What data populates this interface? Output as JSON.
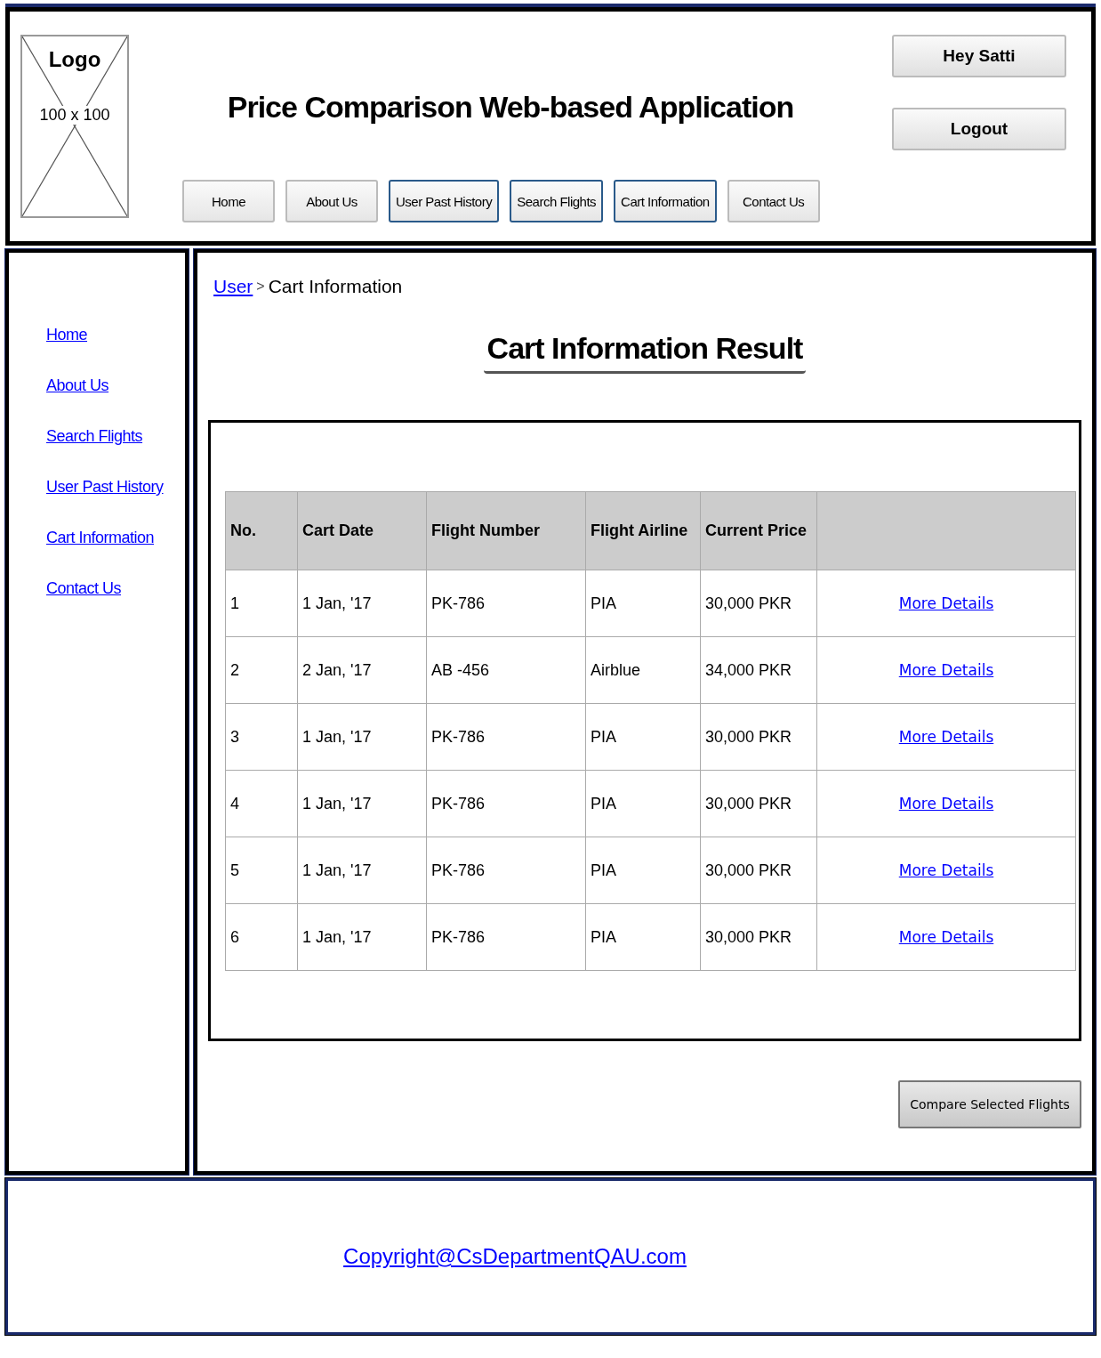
{
  "logo": {
    "label": "Logo",
    "size": "100 x 100"
  },
  "title": "Price Comparison Web-based Application",
  "user_buttons": [
    "Hey Satti",
    "Logout"
  ],
  "nav": [
    {
      "label": "Home",
      "kind": "plain"
    },
    {
      "label": "About Us",
      "kind": "plain"
    },
    {
      "label": "User Past History",
      "kind": "outlined"
    },
    {
      "label": "Search Flights",
      "kind": "outlined"
    },
    {
      "label": "Cart Information",
      "kind": "outlined"
    },
    {
      "label": "Contact Us",
      "kind": "plain"
    }
  ],
  "sidebar": {
    "items": [
      "Home",
      "About Us",
      "Search Flights",
      "User Past History",
      "Cart Information",
      "Contact Us"
    ]
  },
  "breadcrumb": {
    "link": "User",
    "separator": ">",
    "current": "Cart Information"
  },
  "heading": "Cart Information Result",
  "table": {
    "columns": [
      "No.",
      "Cart Date",
      "Flight Number",
      "Flight Airline",
      "Current Price"
    ],
    "rows": [
      {
        "cells": [
          "1",
          "1 Jan, '17",
          "PK-786",
          "PIA",
          "30,000 PKR"
        ],
        "link": "More Details"
      },
      {
        "cells": [
          "2",
          "2 Jan, '17",
          "AB -456",
          "Airblue",
          "34,000 PKR"
        ],
        "link": "More Details"
      },
      {
        "cells": [
          "3",
          "1 Jan, '17",
          "PK-786",
          "PIA",
          "30,000 PKR"
        ],
        "link": "More Details"
      },
      {
        "cells": [
          "4",
          "1 Jan, '17",
          "PK-786",
          "PIA",
          "30,000 PKR"
        ],
        "link": "More Details"
      },
      {
        "cells": [
          "5",
          "1 Jan, '17",
          "PK-786",
          "PIA",
          "30,000 PKR"
        ],
        "link": "More Details"
      },
      {
        "cells": [
          "6",
          "1 Jan, '17",
          "PK-786",
          "PIA",
          "30,000 PKR"
        ],
        "link": "More Details"
      }
    ]
  },
  "compare_button": "Compare Selected Flights",
  "footer": {
    "copyright": "Copyright@CsDepartmentQAU.com"
  }
}
